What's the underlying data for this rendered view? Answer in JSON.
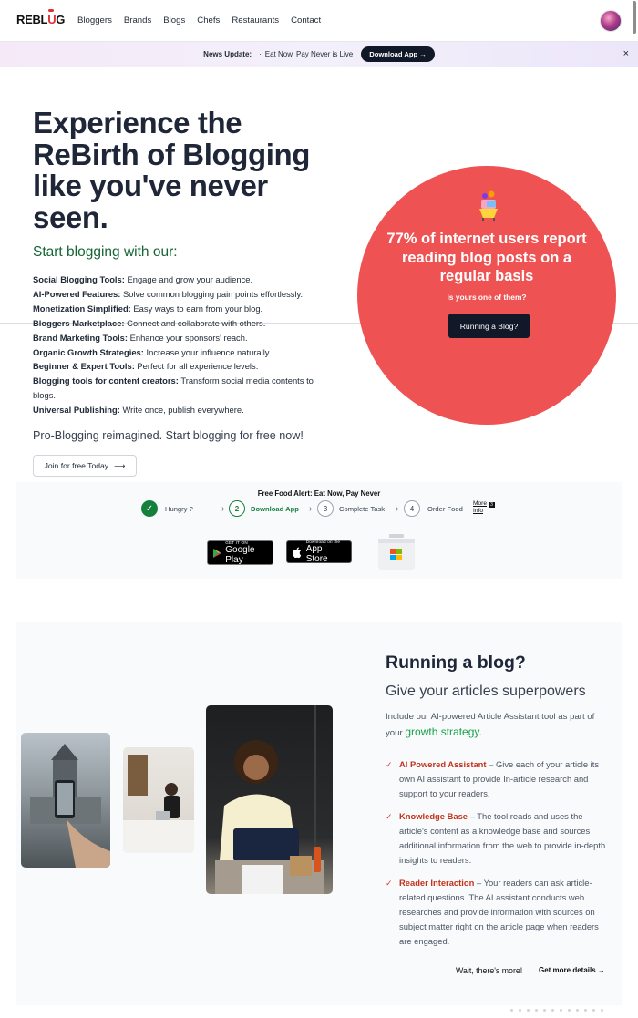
{
  "nav": {
    "logo_pre": "REBL",
    "logo_u": "U",
    "logo_post": "G",
    "links": [
      "Bloggers",
      "Brands",
      "Blogs",
      "Chefs",
      "Restaurants",
      "Contact"
    ]
  },
  "news": {
    "label": "News Update:",
    "sep": "·",
    "text": "Eat Now, Pay Never is Live",
    "button": "Download App →",
    "close": "×"
  },
  "hero": {
    "title": "Experience the ReBirth of Blogging like you've never seen.",
    "subtitle": "Start blogging with our:",
    "features": [
      {
        "bold": "Social Blogging Tools:",
        "text": " Engage and grow your audience."
      },
      {
        "bold": "AI-Powered Features:",
        "text": " Solve common blogging pain points effortlessly."
      },
      {
        "bold": "Monetization Simplified:",
        "text": " Easy ways to earn from your blog."
      },
      {
        "bold": "Bloggers Marketplace:",
        "text": " Connect and collaborate with others."
      },
      {
        "bold": "Brand Marketing Tools:",
        "text": " Enhance your sponsors' reach."
      },
      {
        "bold": "Organic Growth Strategies:",
        "text": " Increase your influence naturally."
      },
      {
        "bold": "Beginner & Expert Tools:",
        "text": " Perfect for all experience levels."
      },
      {
        "bold": "Blogging tools for content creators:",
        "text": " Transform social media contents to blogs."
      },
      {
        "bold": "Universal Publishing:",
        "text": " Write once, publish everywhere."
      }
    ],
    "tagline": "Pro-Blogging reimagined. Start blogging for free now!",
    "join_button": "Join for free Today",
    "join_arrow": "⟶"
  },
  "stat": {
    "title": "77% of internet users report reading blog posts on a regular basis",
    "question": "Is yours one of them?",
    "button": "Running a Blog?"
  },
  "food": {
    "title": "Free Food Alert: Eat Now, Pay Never",
    "steps": [
      {
        "num": "✓",
        "label": "Hungry ?"
      },
      {
        "num": "2",
        "label": "Download App"
      },
      {
        "num": "3",
        "label": "Complete Task"
      },
      {
        "num": "4",
        "label": "Order Food"
      }
    ],
    "more_info": "More Info",
    "more_badge": "3",
    "google": {
      "small": "GET IT ON",
      "big": "Google Play"
    },
    "apple": {
      "small": "Download on the",
      "big": "App Store"
    }
  },
  "blog": {
    "heading": "Running a blog?",
    "subheading": "Give your articles superpowers",
    "intro": "Include our AI-powered Article Assistant tool as part of your ",
    "intro_highlight": "growth strategy.",
    "bullets": [
      {
        "title": "AI Powered Assistant",
        "text": " – Give each of your article its own AI assistant to provide In-article research and support to your readers."
      },
      {
        "title": "Knowledge Base",
        "text": " – The tool reads and uses the article's content as a knowledge base and sources additional information from the web to provide in-depth insights to readers."
      },
      {
        "title": "Reader Interaction",
        "text": " – Your readers can ask article-related questions. The AI assistant conducts web researches and provide information with sources on subject matter right on the article page when readers are engaged."
      }
    ],
    "wait": "Wait, there's more!",
    "details": "Get more details →"
  },
  "colors": {
    "accent_red": "#ef5252",
    "accent_green": "#15803d",
    "dark": "#111827"
  }
}
